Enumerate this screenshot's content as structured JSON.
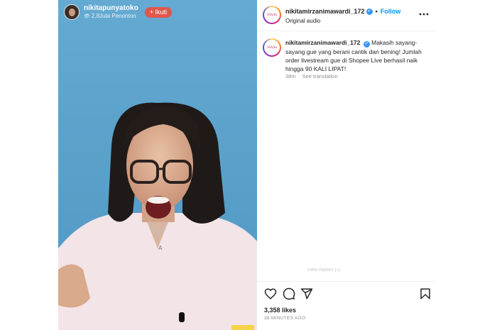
{
  "live": {
    "host_name": "nikitapunyatoko",
    "viewers": "2,8Juta Penonton",
    "follow_label": "+ Ikuti"
  },
  "post": {
    "username": "nikitamirzanimawardi_172",
    "follow_label": "Follow",
    "audio_label": "Original audio",
    "avatar_logo_text": "Nikita"
  },
  "comment": {
    "username": "nikitamirzanimawardi_172",
    "text": "Makasih sayang-sayang gue yang berani cantik dan bening! Jumlah order livestream gue di Shopee Live berhasil naik hingga 90 KALI LIPAT!",
    "age": "38m",
    "translate_label": "See translation"
  },
  "replies_label": "View replies (1)",
  "actions": {
    "icons": [
      "heart-icon",
      "comment-icon",
      "share-icon",
      "bookmark-icon"
    ]
  },
  "likes": "3,358 likes",
  "timestamp": "38 MINUTES AGO",
  "colors": {
    "follow_blue": "#0095f6",
    "verified_blue": "#3897f0",
    "live_follow_red": "#e0574c",
    "media_bg": "#5fa7cf"
  }
}
